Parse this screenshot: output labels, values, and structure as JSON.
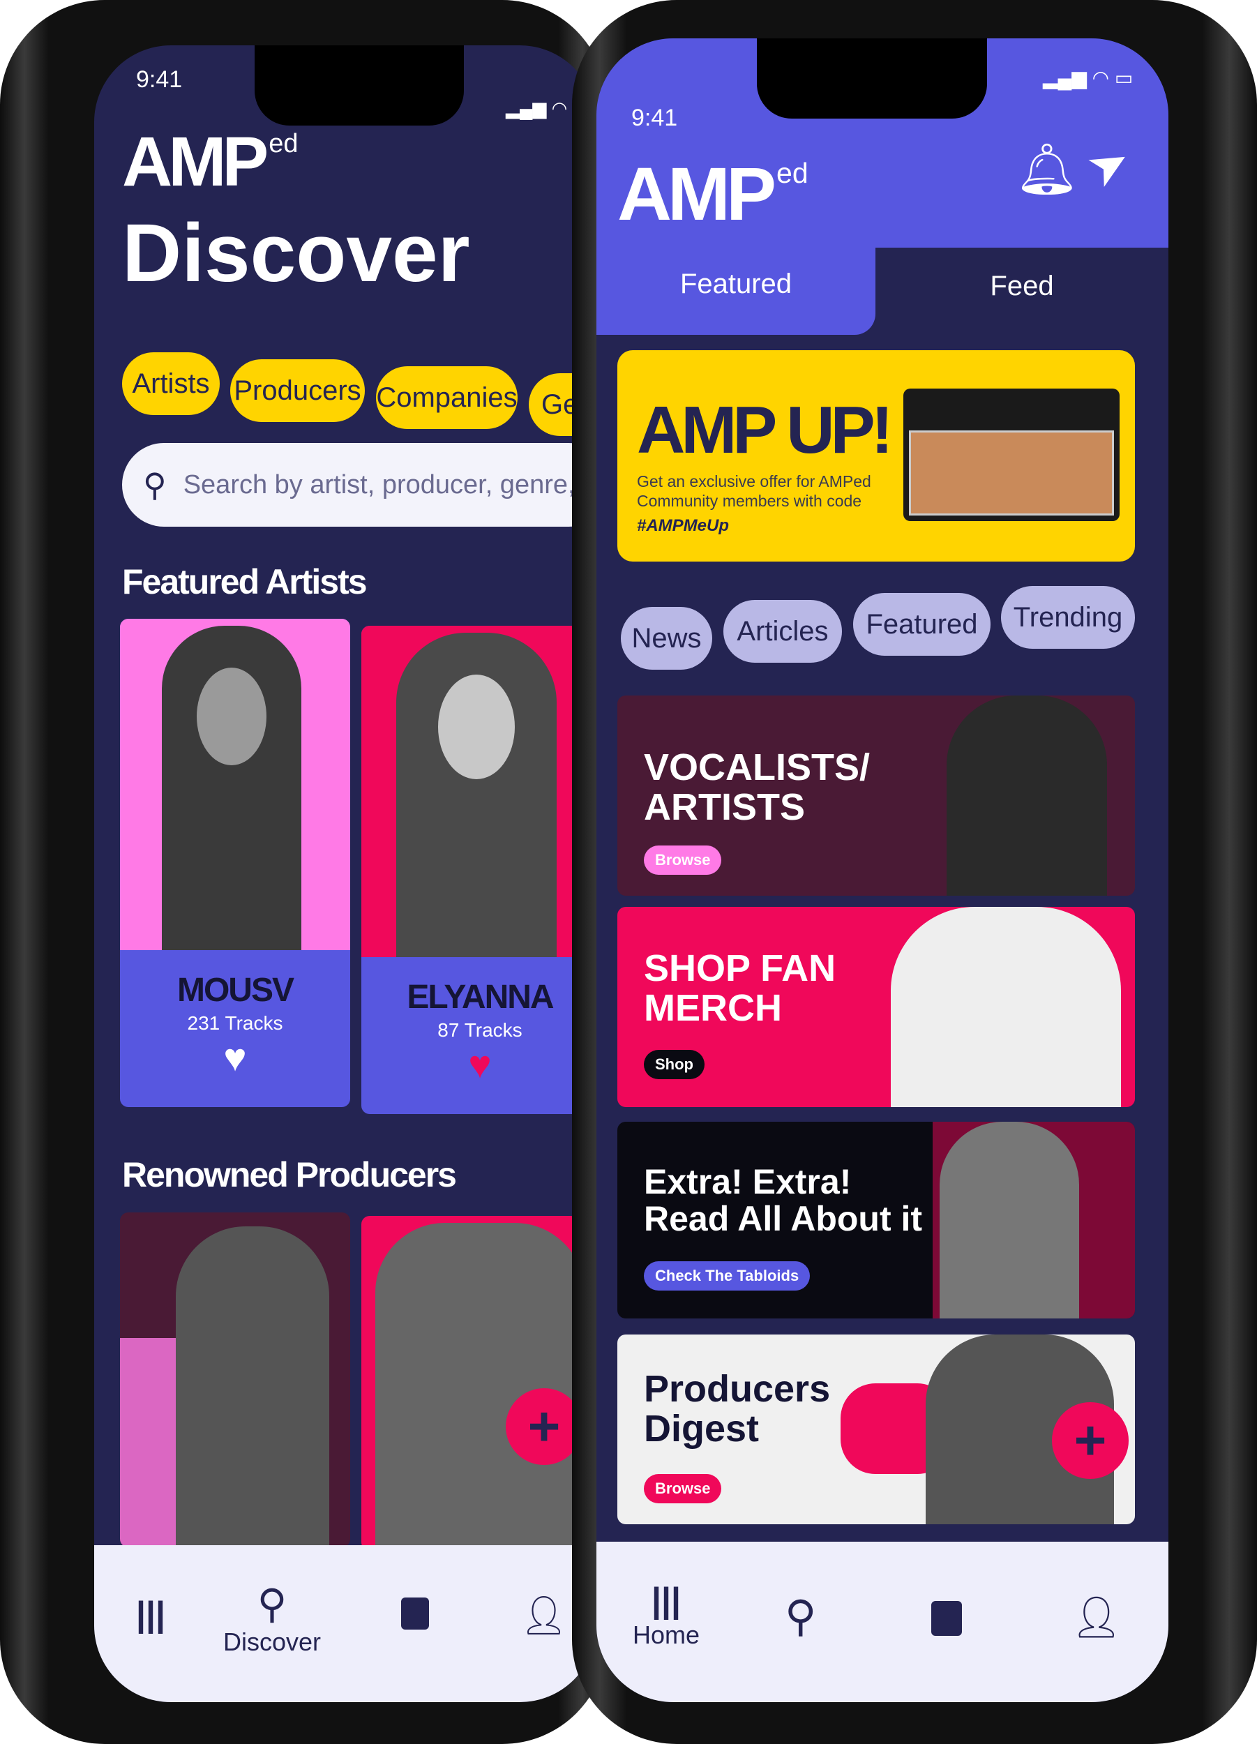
{
  "left_phone": {
    "status_time": "9:41",
    "logo": {
      "main": "AMP",
      "sup": "ed"
    },
    "title": "Discover",
    "filter_chips": [
      "Artists",
      "Producers",
      "Companies",
      "Ge"
    ],
    "search": {
      "placeholder": "Search by artist, producer, genre, ..."
    },
    "featured_artists": {
      "heading": "Featured Artists",
      "items": [
        {
          "name": "MOUSV",
          "tracks": "231 Tracks",
          "liked": false
        },
        {
          "name": "ELYANNA",
          "tracks": "87 Tracks",
          "liked": true
        }
      ]
    },
    "renowned_producers": {
      "heading": "Renowned Producers"
    },
    "fab": "+",
    "nav": {
      "items": [
        {
          "icon": "library-icon",
          "label": ""
        },
        {
          "icon": "search-icon",
          "label": "Discover"
        },
        {
          "icon": "bag-icon",
          "label": ""
        },
        {
          "icon": "user-icon",
          "label": ""
        }
      ],
      "active": 1
    }
  },
  "right_phone": {
    "status_time": "9:41",
    "logo": {
      "main": "AMP",
      "sup": "ed"
    },
    "tabs": [
      "Featured",
      "Feed"
    ],
    "active_tab": 0,
    "promo": {
      "title": "AMP UP!",
      "text": "Get an exclusive offer for AMPed Community members with code",
      "code": "#AMPMeUp"
    },
    "filter_chips": [
      "News",
      "Articles",
      "Featured",
      "Trending"
    ],
    "cards": [
      {
        "title_lines": [
          "VOCALISTS/",
          "ARTISTS"
        ],
        "button": "Browse",
        "bg": "#4a1a35"
      },
      {
        "title_lines": [
          "SHOP FAN",
          "MERCH"
        ],
        "button": "Shop",
        "bg": "#f0085a"
      },
      {
        "title_lines": [
          "Extra! Extra!",
          "Read All About it"
        ],
        "button": "Check The Tabloids",
        "bg": "#0a0a12"
      },
      {
        "title_lines": [
          "Producers",
          "Digest"
        ],
        "button": "Browse",
        "bg": "#f0f0f0"
      }
    ],
    "fab": "+",
    "nav": {
      "items": [
        {
          "icon": "library-icon",
          "label": "Home"
        },
        {
          "icon": "search-icon",
          "label": ""
        },
        {
          "icon": "bag-icon",
          "label": ""
        },
        {
          "icon": "user-icon",
          "label": ""
        }
      ],
      "active": 0
    }
  },
  "colors": {
    "navy": "#242452",
    "purple": "#5757e0",
    "yellow": "#ffd400",
    "pink": "#f0085a",
    "lavender": "#b9b8e6"
  }
}
